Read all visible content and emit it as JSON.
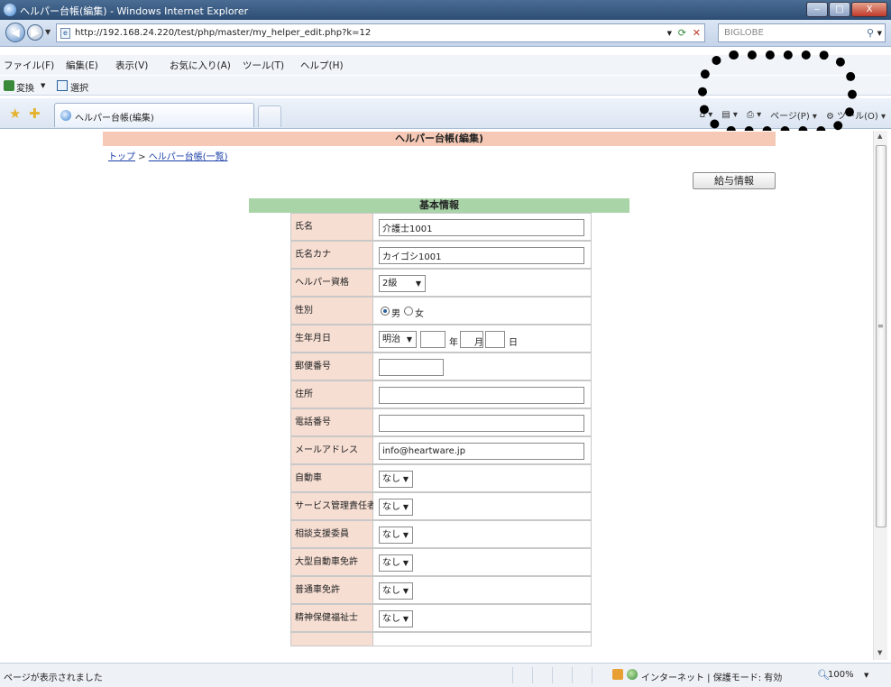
{
  "window": {
    "title": "ヘルパー台帳(編集) - Windows Internet Explorer",
    "minimize": "‒",
    "maximize": "□",
    "close": "X"
  },
  "address": {
    "url": "http://192.168.24.220/test/php/master/my_helper_edit.php?k=12",
    "search_provider": "BIGLOBE"
  },
  "menu": [
    "ファイル(F)",
    "編集(E)",
    "表示(V)",
    "お気に入り(A)",
    "ツール(T)",
    "ヘルプ(H)"
  ],
  "command_bar": {
    "convert_label": "変換",
    "select_label": "選択"
  },
  "tab": {
    "label": "ヘルパー台帳(編集)"
  },
  "tab_tools": {
    "page": "ページ(P)",
    "tools": "ツール(O)"
  },
  "page": {
    "header": "ヘルパー台帳(編集)",
    "breadcrumb": {
      "top": "トップ",
      "separator": " > ",
      "list": "ヘルパー台帳(一覧)"
    },
    "salary_button": "給与情報",
    "section_title": "基本情報"
  },
  "form": {
    "name_label": "氏名",
    "name_value": "介護士1001",
    "kana_label": "氏名カナ",
    "kana_value": "カイゴシ1001",
    "qual_label": "ヘルパー資格",
    "qual_value": "2級",
    "gender_label": "性別",
    "gender_male": "男",
    "gender_female": "女",
    "birth_label": "生年月日",
    "era_value": "明治",
    "year_unit": "年",
    "month_unit": "月",
    "day_unit": "日",
    "postal_label": "郵便番号",
    "address_label": "住所",
    "phone_label": "電話番号",
    "email_label": "メールアドレス",
    "email_value": "info@heartware.jp",
    "car_label": "自動車",
    "car_value": "なし",
    "service_mgr_label": "サービス管理責任者",
    "service_mgr_value": "なし",
    "consult_label": "相談支援委員",
    "consult_value": "なし",
    "large_license_label": "大型自動車免許",
    "large_license_value": "なし",
    "normal_license_label": "普通車免許",
    "normal_license_value": "なし",
    "psw_label": "精神保健福祉士",
    "psw_value": "なし"
  },
  "status": {
    "text": "ページが表示されました",
    "zone": "インターネット | 保護モード: 有効",
    "zoom": "100%"
  },
  "colors": {
    "page_header_bg": "#f5c9b6",
    "section_header_bg": "#a8d4a8",
    "label_cell_bg": "#f6ded3",
    "titlebar": "#2d4d74"
  }
}
